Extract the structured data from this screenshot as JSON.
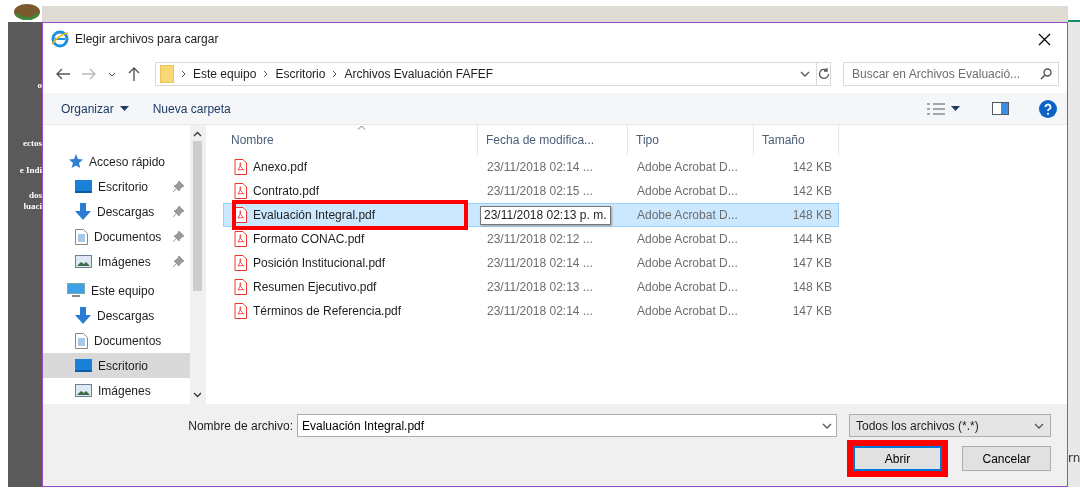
{
  "background_page": {
    "side_texts": [
      "o",
      "ectos",
      "e Indi",
      "dos",
      "luaci"
    ],
    "right_text": "rn"
  },
  "dialog": {
    "title": "Elegir archivos para cargar",
    "breadcrumb": [
      "Este equipo",
      "Escritorio",
      "Archivos Evaluación FAFEF"
    ],
    "search": {
      "placeholder": "Buscar en Archivos Evaluació..."
    },
    "toolbar": {
      "organize": "Organizar",
      "new_folder": "Nueva carpeta"
    },
    "nav": [
      {
        "label": "Acceso rápido",
        "kind": "quick",
        "pinned": false,
        "selected": false
      },
      {
        "label": "Escritorio",
        "kind": "desktop",
        "pinned": true,
        "selected": false
      },
      {
        "label": "Descargas",
        "kind": "downloads",
        "pinned": true,
        "selected": false
      },
      {
        "label": "Documentos",
        "kind": "documents",
        "pinned": true,
        "selected": false
      },
      {
        "label": "Imágenes",
        "kind": "pictures",
        "pinned": true,
        "selected": false
      },
      {
        "label": "Este equipo",
        "kind": "pc",
        "pinned": false,
        "selected": false
      },
      {
        "label": "Descargas",
        "kind": "downloads",
        "pinned": false,
        "selected": false
      },
      {
        "label": "Documentos",
        "kind": "documents",
        "pinned": false,
        "selected": false
      },
      {
        "label": "Escritorio",
        "kind": "desktop",
        "pinned": false,
        "selected": true
      },
      {
        "label": "Imágenes",
        "kind": "pictures",
        "pinned": false,
        "selected": false
      }
    ],
    "columns": [
      "Nombre",
      "Fecha de modifica...",
      "Tipo",
      "Tamaño"
    ],
    "files": [
      {
        "name": "Anexo.pdf",
        "date": "23/11/2018 02:14 ...",
        "type": "Adobe Acrobat D...",
        "size": "142 KB",
        "selected": false,
        "tooltip": false,
        "highlighted": false
      },
      {
        "name": "Contrato.pdf",
        "date": "23/11/2018 02:15 ...",
        "type": "Adobe Acrobat D...",
        "size": "142 KB",
        "selected": false,
        "tooltip": false,
        "highlighted": false
      },
      {
        "name": "Evaluación Integral.pdf",
        "date": "23/11/2018 02:13 p. m.",
        "type": "Adobe Acrobat D...",
        "size": "148 KB",
        "selected": true,
        "tooltip": true,
        "highlighted": true
      },
      {
        "name": "Formato CONAC.pdf",
        "date": "23/11/2018 02:12 ...",
        "type": "Adobe Acrobat D...",
        "size": "144 KB",
        "selected": false,
        "tooltip": false,
        "highlighted": false
      },
      {
        "name": "Posición Institucional.pdf",
        "date": "23/11/2018 02:14 ...",
        "type": "Adobe Acrobat D...",
        "size": "147 KB",
        "selected": false,
        "tooltip": false,
        "highlighted": false
      },
      {
        "name": "Resumen Ejecutivo.pdf",
        "date": "23/11/2018 02:13 ...",
        "type": "Adobe Acrobat D...",
        "size": "148 KB",
        "selected": false,
        "tooltip": false,
        "highlighted": false
      },
      {
        "name": "Términos de Referencia.pdf",
        "date": "23/11/2018 02:14 ...",
        "type": "Adobe Acrobat D...",
        "size": "147 KB",
        "selected": false,
        "tooltip": false,
        "highlighted": false
      }
    ],
    "file_name": {
      "label": "Nombre de archivo:",
      "value": "Evaluación Integral.pdf"
    },
    "file_type": "Todos los archivos (*.*)",
    "buttons": [
      {
        "label": "Abrir",
        "default": true,
        "highlighted": true
      },
      {
        "label": "Cancelar",
        "default": false,
        "highlighted": false
      }
    ]
  }
}
